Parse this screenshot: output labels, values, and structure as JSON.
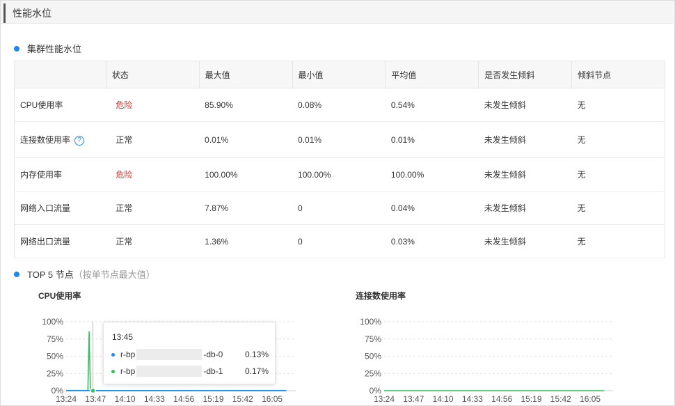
{
  "header": {
    "title": "性能水位"
  },
  "cluster_section": {
    "title": "集群性能水位"
  },
  "table": {
    "columns": [
      "",
      "状态",
      "最大值",
      "最小值",
      "平均值",
      "是否发生倾斜",
      "倾斜节点"
    ],
    "rows": [
      {
        "metric": "CPU使用率",
        "status": "危险",
        "status_level": "danger",
        "max": "85.90%",
        "min": "0.08%",
        "avg": "0.54%",
        "skew": "未发生倾斜",
        "skew_node": "无",
        "help": false
      },
      {
        "metric": "连接数使用率",
        "status": "正常",
        "status_level": "normal",
        "max": "0.01%",
        "min": "0.01%",
        "avg": "0.01%",
        "skew": "未发生倾斜",
        "skew_node": "无",
        "help": true
      },
      {
        "metric": "内存使用率",
        "status": "危险",
        "status_level": "danger",
        "max": "100.00%",
        "min": "100.00%",
        "avg": "100.00%",
        "skew": "未发生倾斜",
        "skew_node": "无",
        "help": false
      },
      {
        "metric": "网络入口流量",
        "status": "正常",
        "status_level": "normal",
        "max": "7.87%",
        "min": "0",
        "avg": "0.04%",
        "skew": "未发生倾斜",
        "skew_node": "无",
        "help": false
      },
      {
        "metric": "网络出口流量",
        "status": "正常",
        "status_level": "normal",
        "max": "1.36%",
        "min": "0",
        "avg": "0.03%",
        "skew": "未发生倾斜",
        "skew_node": "无",
        "help": false
      }
    ],
    "help_icon": "question-circle-icon"
  },
  "top5_section": {
    "title": "TOP 5 节点",
    "subtitle": "（按单节点最大值）"
  },
  "colors": {
    "accent": "#1e87f0",
    "danger": "#d93026",
    "series_green": "#2fc25b",
    "series_blue": "#1e87f0"
  },
  "tooltip": {
    "time": "13:45",
    "rows": [
      {
        "prefix": "r-bp",
        "suffix": "-db-0",
        "value": "0.13%",
        "color": "#1e87f0"
      },
      {
        "prefix": "r-bp",
        "suffix": "-db-1",
        "value": "0.17%",
        "color": "#2fc25b"
      }
    ]
  },
  "chart_data": [
    {
      "type": "line",
      "title": "CPU使用率",
      "yticks": [
        "100%",
        "75%",
        "50%",
        "25%",
        "0%"
      ],
      "ylim": [
        0,
        100
      ],
      "xticks": [
        "13:24",
        "13:47",
        "14:10",
        "14:33",
        "14:56",
        "15:19",
        "15:42",
        "16:05"
      ],
      "grid": true,
      "series": [
        {
          "color": "#2fc25b",
          "x": [
            "13:24",
            "13:41",
            "13:42",
            "13:43",
            "13:44",
            "13:45",
            "16:05",
            "16:16"
          ],
          "values": [
            0.3,
            0.3,
            85.9,
            0.3,
            0.3,
            0.2,
            0.3,
            0.3
          ]
        },
        {
          "color": "#1e87f0",
          "x": [
            "13:24",
            "16:16"
          ],
          "values": [
            0.1,
            0.1
          ]
        }
      ]
    },
    {
      "type": "line",
      "title": "连接数使用率",
      "yticks": [
        "100%",
        "75%",
        "50%",
        "25%",
        "0%"
      ],
      "ylim": [
        0,
        100
      ],
      "xticks": [
        "13:24",
        "13:47",
        "14:10",
        "14:33",
        "14:56",
        "15:19",
        "15:42",
        "16:05"
      ],
      "grid": true,
      "series": [
        {
          "color": "#2fc25b",
          "x": [
            "13:24",
            "16:16"
          ],
          "values": [
            0.01,
            0.01
          ]
        }
      ]
    }
  ]
}
